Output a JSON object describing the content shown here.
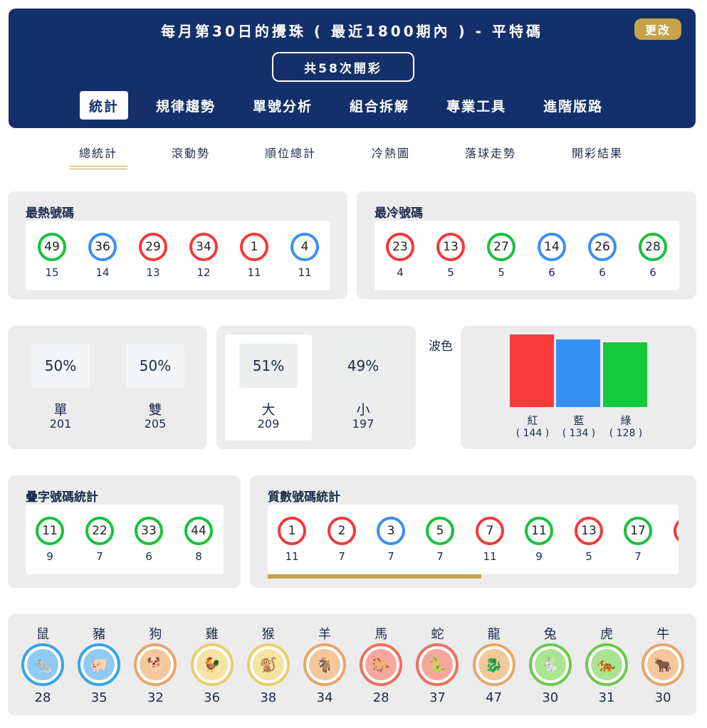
{
  "header": {
    "title": "每月第30日的攪珠 ( 最近1800期內 ) - 平特碼",
    "change_label": "更改",
    "draws_label": "共58次開彩",
    "tabs": [
      {
        "label": "統計",
        "active": true
      },
      {
        "label": "規律趨勢",
        "active": false
      },
      {
        "label": "單號分析",
        "active": false
      },
      {
        "label": "組合拆解",
        "active": false
      },
      {
        "label": "專業工具",
        "active": false
      },
      {
        "label": "進階版路",
        "active": false
      }
    ]
  },
  "subtabs": [
    "總統計",
    "滾動勢",
    "順位總計",
    "冷熱圖",
    "落球走勢",
    "開彩結果"
  ],
  "hot": {
    "title": "最熱號碼",
    "balls": [
      {
        "num": "49",
        "color": "green",
        "count": "15"
      },
      {
        "num": "36",
        "color": "blue",
        "count": "14"
      },
      {
        "num": "29",
        "color": "red",
        "count": "13"
      },
      {
        "num": "34",
        "color": "red",
        "count": "12"
      },
      {
        "num": "1",
        "color": "red",
        "count": "11"
      },
      {
        "num": "4",
        "color": "blue",
        "count": "11"
      }
    ]
  },
  "cold": {
    "title": "最冷號碼",
    "balls": [
      {
        "num": "23",
        "color": "red",
        "count": "4"
      },
      {
        "num": "13",
        "color": "red",
        "count": "5"
      },
      {
        "num": "27",
        "color": "green",
        "count": "5"
      },
      {
        "num": "14",
        "color": "blue",
        "count": "6"
      },
      {
        "num": "26",
        "color": "blue",
        "count": "6"
      },
      {
        "num": "28",
        "color": "green",
        "count": "6"
      }
    ]
  },
  "odd_even": [
    {
      "pct": "50%",
      "label": "單",
      "count": "201"
    },
    {
      "pct": "50%",
      "label": "雙",
      "count": "205"
    }
  ],
  "big_small": [
    {
      "pct": "51%",
      "label": "大",
      "count": "209"
    },
    {
      "pct": "49%",
      "label": "小",
      "count": "197"
    }
  ],
  "wave": {
    "title": "波色",
    "chart_data": {
      "type": "bar",
      "categories": [
        "紅",
        "藍",
        "綠"
      ],
      "values": [
        144,
        134,
        128
      ],
      "value_labels": [
        "( 144 )",
        "( 134 )",
        "( 128 )"
      ],
      "colors": [
        "#fb3b3b",
        "#3491f4",
        "#14c93b"
      ]
    }
  },
  "repeat": {
    "title": "疊字號碼統計",
    "balls": [
      {
        "num": "11",
        "color": "green",
        "count": "9"
      },
      {
        "num": "22",
        "color": "green",
        "count": "7"
      },
      {
        "num": "33",
        "color": "green",
        "count": "6"
      },
      {
        "num": "44",
        "color": "green",
        "count": "8"
      }
    ]
  },
  "prime": {
    "title": "質數號碼統計",
    "balls": [
      {
        "num": "1",
        "color": "red",
        "count": "11"
      },
      {
        "num": "2",
        "color": "red",
        "count": "7"
      },
      {
        "num": "3",
        "color": "blue",
        "count": "7"
      },
      {
        "num": "5",
        "color": "green",
        "count": "7"
      },
      {
        "num": "7",
        "color": "red",
        "count": "11"
      },
      {
        "num": "11",
        "color": "green",
        "count": "9"
      },
      {
        "num": "13",
        "color": "red",
        "count": "5"
      },
      {
        "num": "17",
        "color": "green",
        "count": "7"
      },
      {
        "num": "",
        "color": "red",
        "count": ""
      }
    ],
    "scroll_fraction": 0.52
  },
  "zodiac": [
    {
      "name": "鼠",
      "count": "28",
      "ring": "#3aa4e8",
      "core": "#8fcaf2",
      "icon": "rat-icon",
      "glyph": "🐀"
    },
    {
      "name": "豬",
      "count": "35",
      "ring": "#3aa4e8",
      "core": "#8fcaf2",
      "icon": "pig-icon",
      "glyph": "🐖"
    },
    {
      "name": "狗",
      "count": "32",
      "ring": "#e8a66a",
      "core": "#f3c89a",
      "icon": "dog-icon",
      "glyph": "🐕"
    },
    {
      "name": "雞",
      "count": "36",
      "ring": "#e8cf6a",
      "core": "#f6e3a1",
      "icon": "rooster-icon",
      "glyph": "🐓"
    },
    {
      "name": "猴",
      "count": "38",
      "ring": "#e8cf6a",
      "core": "#f6e3a1",
      "icon": "monkey-icon",
      "glyph": "🐒"
    },
    {
      "name": "羊",
      "count": "34",
      "ring": "#e8a66a",
      "core": "#f3c89a",
      "icon": "goat-icon",
      "glyph": "🐐"
    },
    {
      "name": "馬",
      "count": "28",
      "ring": "#ee6f5f",
      "core": "#f6a79b",
      "icon": "horse-icon",
      "glyph": "🐎"
    },
    {
      "name": "蛇",
      "count": "37",
      "ring": "#ee6f5f",
      "core": "#f6a79b",
      "icon": "snake-icon",
      "glyph": "🐍"
    },
    {
      "name": "龍",
      "count": "47",
      "ring": "#e8a66a",
      "core": "#f3c89a",
      "icon": "dragon-icon",
      "glyph": "🐉"
    },
    {
      "name": "兔",
      "count": "30",
      "ring": "#6cc94a",
      "core": "#a9e48f",
      "icon": "rabbit-icon",
      "glyph": "🐇"
    },
    {
      "name": "虎",
      "count": "31",
      "ring": "#6cc94a",
      "core": "#a9e48f",
      "icon": "tiger-icon",
      "glyph": "🐅"
    },
    {
      "name": "牛",
      "count": "30",
      "ring": "#e8a66a",
      "core": "#f3c89a",
      "icon": "ox-icon",
      "glyph": "🐂"
    }
  ]
}
